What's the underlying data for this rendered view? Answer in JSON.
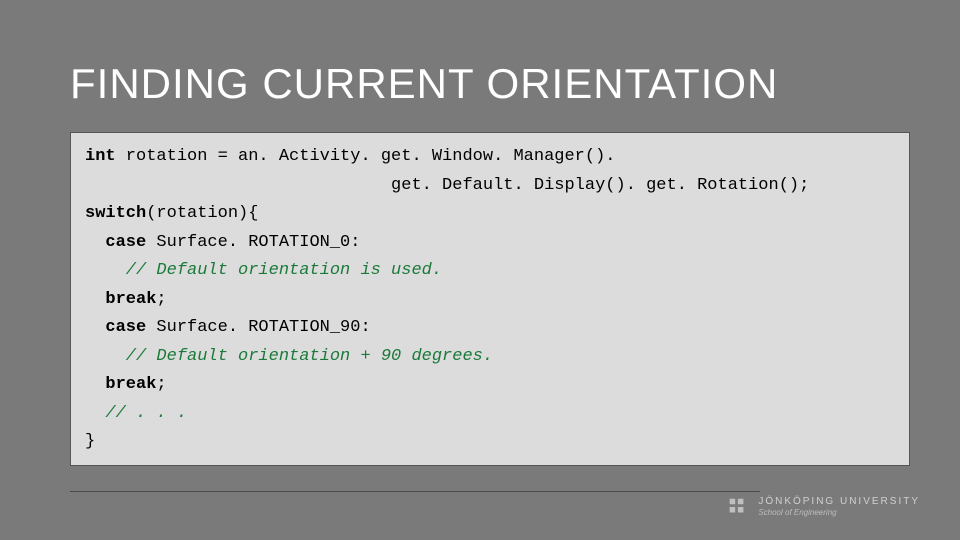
{
  "slide": {
    "title": "FINDING CURRENT ORIENTATION"
  },
  "code": {
    "l1a": "int",
    "l1b": " rotation = an. Activity. get. Window. Manager().",
    "l2": "                              get. Default. Display(). get. Rotation();",
    "l3a": "switch",
    "l3b": "(rotation){",
    "l4a": "  case",
    "l4b": " Surface. ROTATION_0:",
    "l5": "    // Default orientation is used.",
    "l6a": "  break",
    "l6b": ";",
    "l7a": "  case",
    "l7b": " Surface. ROTATION_90:",
    "l8": "    // Default orientation + 90 degrees.",
    "l9a": "  break",
    "l9b": ";",
    "l10": "  // . . .",
    "l11": "}"
  },
  "footer": {
    "university": "JÖNKÖPING UNIVERSITY",
    "school": "School of Engineering"
  }
}
